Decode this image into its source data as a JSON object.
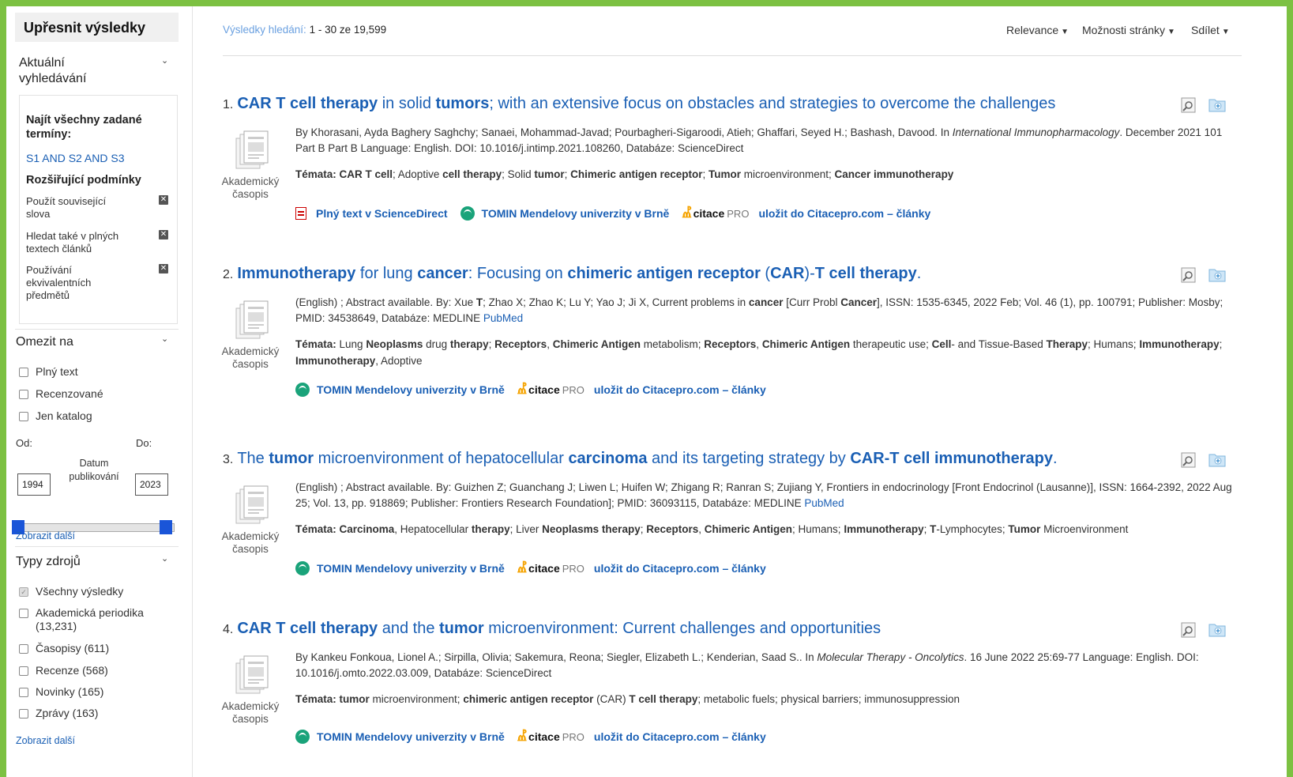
{
  "sidebar": {
    "refine_title": "Upřesnit výsledky",
    "current_search_title": "Aktuální vyhledávání",
    "find_all_terms_label": "Najít všechny zadané termíny:",
    "query": "S1 AND S2 AND S3",
    "expanders_title": "Rozšiřující podmínky",
    "expanders": [
      "Použít související slova",
      "Hledat také v plných textech článků",
      "Používání ekvivalentních předmětů"
    ],
    "limit_title": "Omezit na",
    "limits": [
      "Plný text",
      "Recenzované",
      "Jen katalog"
    ],
    "from_label": "Od:",
    "to_label": "Do:",
    "from_year": "1994",
    "to_year": "2023",
    "date_label": "Datum publikování",
    "show_more": "Zobrazit další",
    "source_types_title": "Typy zdrojů",
    "source_types": [
      {
        "label": "Všechny výsledky",
        "checked": true
      },
      {
        "label": "Akademická periodika (13,231)",
        "checked": false
      },
      {
        "label": "Časopisy (611)",
        "checked": false
      },
      {
        "label": "Recenze (568)",
        "checked": false
      },
      {
        "label": "Novinky (165)",
        "checked": false
      },
      {
        "label": "Zprávy (163)",
        "checked": false
      }
    ],
    "show_more_2": "Zobrazit další"
  },
  "topbar": {
    "results_label": "Výsledky hledání:",
    "results_count": "1 - 30 ze 19,599",
    "relevance": "Relevance",
    "page_options": "Možnosti stránky",
    "share": "Sdílet"
  },
  "doc_type": "Akademický časopis",
  "links": {
    "fulltext": "Plný text v ScienceDirect",
    "tomin": "TOMIN Mendelovy univerzity v Brně",
    "citace": "citace",
    "citace_pro": "PRO",
    "save": "uložit do Citacepro.com – články"
  },
  "results": [
    {
      "num": "1.",
      "meta_html": "By Khorasani, Ayda Baghery Saghchy; Sanaei, Mohammad-Javad; Pourbagheri-Sigaroodi, Atieh; Ghaffari, Seyed H.; Bashash, Davood. In <i>International Immunopharmacology</i>. December 2021 101 Part B Part B Language: English. DOI: 10.1016/j.intimp.2021.108260, Databáze: ScienceDirect",
      "topics_html": "<b>Témata: CAR T cell</b>; Adoptive <b>cell therapy</b>; Solid <b>tumor</b>; <b>Chimeric antigen receptor</b>; <b>Tumor</b> microenvironment; <b>Cancer immunotherapy</b>"
    },
    {
      "num": "2.",
      "meta_html": "(English) ; Abstract available. By: Xue <b>T</b>; Zhao X; Zhao K; Lu Y; Yao J; Ji X, Current problems in <b>cancer</b> [Curr Probl <b>Cancer</b>], ISSN: 1535-6345, 2022 Feb; Vol. 46 (1), pp. 100791; Publisher: Mosby; PMID: 34538649, Databáze: MEDLINE <span class=\"lk\">PubMed</span>",
      "topics_html": "<b>Témata:</b> Lung <b>Neoplasms</b> drug <b>therapy</b>; <b>Receptors</b>, <b>Chimeric Antigen</b> metabolism; <b>Receptors</b>, <b>Chimeric Antigen</b> therapeutic use; <b>Cell</b>- and Tissue-Based <b>Therapy</b>; Humans; <b>Immunotherapy</b>; <b>Immunotherapy</b>, Adoptive"
    },
    {
      "num": "3.",
      "meta_html": "(English) ; Abstract available. By: Guizhen Z; Guanchang J; Liwen L; Huifen W; Zhigang R; Ranran S; Zujiang Y, Frontiers in endocrinology [Front Endocrinol (Lausanne)], ISSN: 1664-2392, 2022 Aug 25; Vol. 13, pp. 918869; Publisher: Frontiers Research Foundation]; PMID: 36093115, Databáze: MEDLINE <span class=\"lk\">PubMed</span>",
      "topics_html": "<b>Témata: Carcinoma</b>, Hepatocellular <b>therapy</b>; Liver <b>Neoplasms therapy</b>; <b>Receptors</b>, <b>Chimeric Antigen</b>; Humans; <b>Immunotherapy</b>; <b>T</b>-Lymphocytes; <b>Tumor</b> Microenvironment"
    },
    {
      "num": "4.",
      "meta_html": "By Kankeu Fonkoua, Lionel A.; Sirpilla, Olivia; Sakemura, Reona; Siegler, Elizabeth L.; Kenderian, Saad S.. In <i>Molecular Therapy - Oncolytics</i>. 16 June 2022 25:69-77 Language: English. DOI: 10.1016/j.omto.2022.03.009, Databáze: ScienceDirect",
      "topics_html": "<b>Témata: tumor</b> microenvironment; <b>chimeric antigen receptor</b> (CAR) <b>T cell therapy</b>; metabolic fuels; physical barriers; immunosuppression"
    }
  ],
  "titles": [
    {
      "parts": [
        [
          "CAR T cell therapy",
          true
        ],
        [
          " in solid ",
          false
        ],
        [
          "tumors",
          true
        ],
        [
          "; with an extensive focus on obstacles and strategies to overcome the challenges",
          false
        ]
      ]
    },
    {
      "parts": [
        [
          "Immunotherapy",
          true
        ],
        [
          " for lung ",
          false
        ],
        [
          "cancer",
          true
        ],
        [
          ": Focusing on ",
          false
        ],
        [
          "chimeric antigen receptor",
          true
        ],
        [
          " (",
          false
        ],
        [
          "CAR",
          true
        ],
        [
          ")-",
          false
        ],
        [
          "T cell therapy",
          true
        ],
        [
          ".",
          false
        ]
      ]
    },
    {
      "parts": [
        [
          "The ",
          false
        ],
        [
          "tumor",
          true
        ],
        [
          " microenvironment of hepatocellular ",
          false
        ],
        [
          "carcinoma",
          true
        ],
        [
          " and its targeting strategy by ",
          false
        ],
        [
          "CAR-T cell immunotherapy",
          true
        ],
        [
          ".",
          false
        ]
      ]
    },
    {
      "parts": [
        [
          "CAR T cell therapy",
          true
        ],
        [
          " and the ",
          false
        ],
        [
          "tumor",
          true
        ],
        [
          " microenvironment: Current challenges and opportunities",
          false
        ]
      ]
    }
  ]
}
